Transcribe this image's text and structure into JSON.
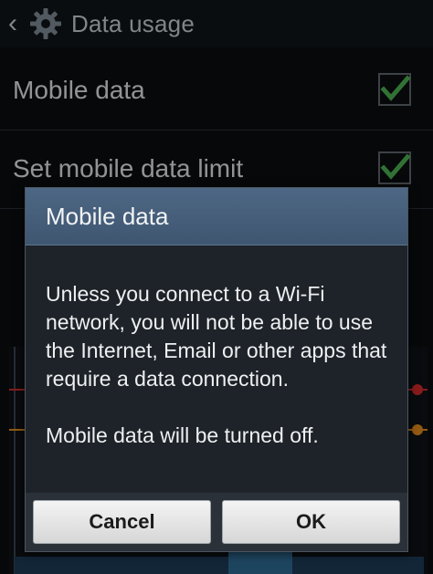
{
  "header": {
    "title": "Data usage"
  },
  "settings": {
    "mobile_data": {
      "label": "Mobile data",
      "checked": true
    },
    "set_limit": {
      "label": "Set mobile data limit",
      "checked": true
    }
  },
  "dialog": {
    "title": "Mobile data",
    "message": "Unless you connect to a Wi-Fi network, you will not be able to use the Internet, Email or other apps that require a data connection.",
    "note": "Mobile data will be turned off.",
    "cancel_label": "Cancel",
    "ok_label": "OK"
  },
  "colors": {
    "accent_check": "#4caf50",
    "dialog_header": "#4d6784",
    "limit_marker_red": "#d22a2a",
    "warning_marker_orange": "#e08a1c"
  }
}
